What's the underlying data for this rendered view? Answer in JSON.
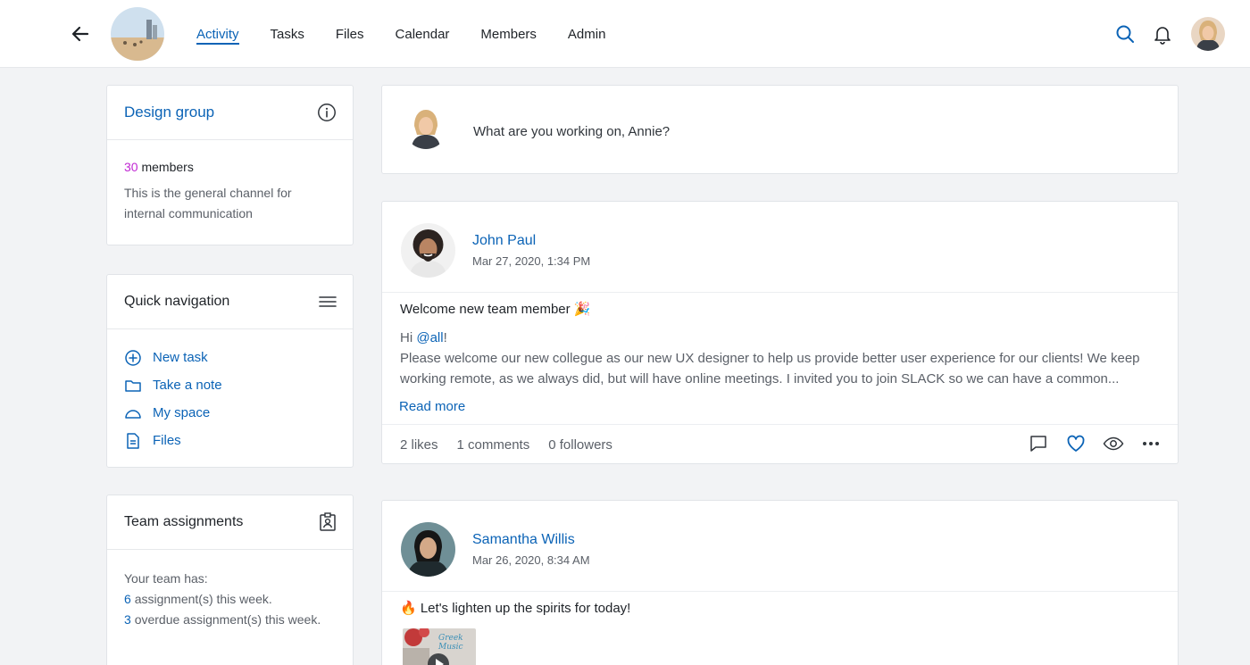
{
  "nav": {
    "tabs": [
      "Activity",
      "Tasks",
      "Files",
      "Calendar",
      "Members",
      "Admin"
    ],
    "active": "Activity"
  },
  "group": {
    "title": "Design group",
    "members_count": "30",
    "members_label": "members",
    "description": "This is the general channel for internal communication"
  },
  "quick_nav": {
    "title": "Quick navigation",
    "items": [
      {
        "label": "New task",
        "icon": "plus-circle-icon"
      },
      {
        "label": "Take a note",
        "icon": "folder-icon"
      },
      {
        "label": "My space",
        "icon": "dome-icon"
      },
      {
        "label": "Files",
        "icon": "document-icon"
      }
    ]
  },
  "team": {
    "title": "Team assignments",
    "intro": "Your team has:",
    "assignments_count": "6",
    "assignments_text": "assignment(s) this week.",
    "overdue_count": "3",
    "overdue_text": "overdue assignment(s) this week."
  },
  "composer": {
    "prompt": "What are you working on, Annie?"
  },
  "posts": [
    {
      "author": "John Paul",
      "date": "Mar 27, 2020, 1:34 PM",
      "title": "Welcome new team member 🎉",
      "greeting_prefix": "Hi ",
      "mention": "@all",
      "greeting_suffix": "!",
      "body": "Please welcome our new collegue as our new UX designer to help us provide better user experience for our clients! We keep working remote, as we always did, but will have online meetings. I invited you to join SLACK so we can have a common...",
      "read_more": "Read more",
      "likes": "2 likes",
      "comments": "1 comments",
      "followers": "0 followers"
    },
    {
      "author": "Samantha Willis",
      "date": "Mar 26, 2020, 8:34 AM",
      "title": "🔥 Let's lighten up the spirits for today!",
      "media_text": "Greek Music"
    }
  ],
  "colors": {
    "accent": "#0b63b6",
    "count_highlight": "#c026d3",
    "background": "#f2f3f5"
  }
}
